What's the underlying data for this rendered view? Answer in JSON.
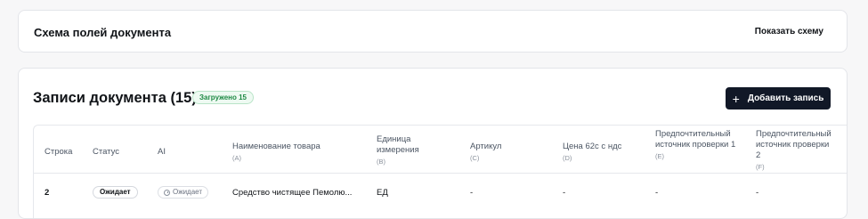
{
  "schema": {
    "title": "Схема полей документа",
    "show_button": "Показать схему"
  },
  "records": {
    "title": "Записи документа (15)",
    "loaded_badge": "Загружено 15",
    "add_button": "Добавить запись",
    "add_icon": "+",
    "columns": [
      {
        "label": "Строка",
        "letter": ""
      },
      {
        "label": "Статус",
        "letter": ""
      },
      {
        "label": "AI",
        "letter": ""
      },
      {
        "label": "Наименование товара",
        "letter": "(A)"
      },
      {
        "label": "Единица измерения",
        "letter": "(B)"
      },
      {
        "label": "Артикул",
        "letter": "(C)"
      },
      {
        "label": "Цена 62с с ндс",
        "letter": "(D)"
      },
      {
        "label": "Предпочтительный источник проверки 1",
        "letter": "(E)"
      },
      {
        "label": "Предпочтительный источник проверки 2",
        "letter": "(F)"
      }
    ],
    "rows": [
      {
        "row": "2",
        "status": "Ожидает",
        "ai": "Ожидает",
        "name": "Средство чистящее Пемолю...",
        "unit": "ЕД",
        "article": "-",
        "price": "-",
        "source1": "-",
        "source2": "-"
      }
    ]
  }
}
